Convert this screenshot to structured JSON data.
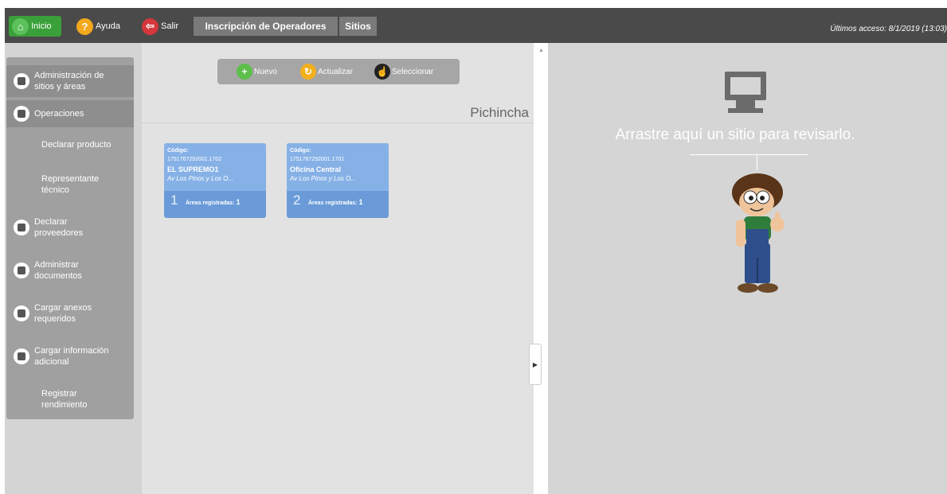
{
  "topbar": {
    "inicio": "Inicio",
    "ayuda": "Ayuda",
    "salir": "Salir",
    "tabs": [
      "Inscripción de Operadores",
      "Sitios"
    ],
    "last_access": "Últimos acceso: 8/1/2019 (13:03)"
  },
  "sidebar": {
    "items": [
      {
        "label": "Administración de\nsitios y áreas"
      },
      {
        "label": "Operaciones"
      },
      {
        "label": "Declarar producto"
      },
      {
        "label": "Representante\ntécnico"
      },
      {
        "label": "Declarar\nproveedores"
      },
      {
        "label": "Administrar\ndocumentos"
      },
      {
        "label": "Cargar anexos\nrequeridos"
      },
      {
        "label": "Cargar información\nadicional"
      },
      {
        "label": "Registrar\nrendimiento"
      }
    ]
  },
  "toolbar": {
    "nuevo": "Nuevo",
    "actualizar": "Actualizar",
    "seleccionar": "Seleccionar"
  },
  "region": "Pichincha",
  "cards": [
    {
      "code_label": "Código:",
      "code": "1751767292001.1702",
      "name": "EL SUPREMO1",
      "address": "Av Los Pinos y Los O...",
      "number": "1",
      "areas_label": "Áreas registradas:",
      "areas": "1"
    },
    {
      "code_label": "Código:",
      "code": "1751767292001.1701",
      "name": "Oficina Central",
      "address": "Av Los Pinos y Los O...",
      "number": "2",
      "areas_label": "Áreas registradas:",
      "areas": "1"
    }
  ],
  "right": {
    "drop_text": "Arrastre aquí un sitio para revisarlo."
  },
  "colors": {
    "topbar": "#4a4a4a",
    "inicio": "#3aa039",
    "card": "#86b1e6",
    "sidebar": "#a0a0a0"
  },
  "icons": [
    "home-icon",
    "help-icon",
    "exit-icon",
    "plus-icon",
    "refresh-icon",
    "select-icon",
    "monitor-icon"
  ]
}
